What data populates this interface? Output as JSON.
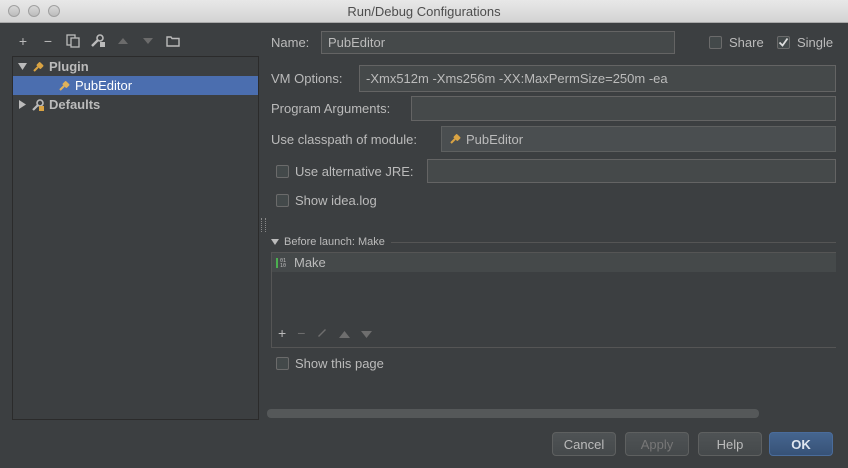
{
  "window": {
    "title": "Run/Debug Configurations"
  },
  "toolbar": {
    "add_label": "+",
    "remove_label": "−"
  },
  "tree": {
    "items": [
      {
        "label": "Plugin"
      },
      {
        "label": "PubEditor"
      },
      {
        "label": "Defaults"
      }
    ]
  },
  "form": {
    "name_label": "Name:",
    "name_value": "PubEditor",
    "share_label": "Share",
    "single_label": "Single",
    "vm_label": "VM Options:",
    "vm_value": "-Xmx512m -Xms256m -XX:MaxPermSize=250m -ea",
    "prog_label": "Program Arguments:",
    "prog_value": "",
    "classpath_label": "Use classpath of module:",
    "classpath_value": "PubEditor",
    "alt_jre_label": "Use alternative JRE:",
    "alt_jre_value": "",
    "show_log_label": "Show idea.log",
    "before_launch_label": "Before launch: Make",
    "before_launch_items": [
      "Make"
    ],
    "show_page_label": "Show this page",
    "share_checked": false,
    "single_checked": true,
    "alt_jre_checked": false,
    "show_log_checked": false,
    "show_page_checked": false
  },
  "buttons": {
    "cancel": "Cancel",
    "apply": "Apply",
    "help": "Help",
    "ok": "OK"
  },
  "colors": {
    "background": "#3c3f41",
    "selection": "#4b6eaf",
    "field": "#45494a",
    "ok_button": "#375277"
  }
}
